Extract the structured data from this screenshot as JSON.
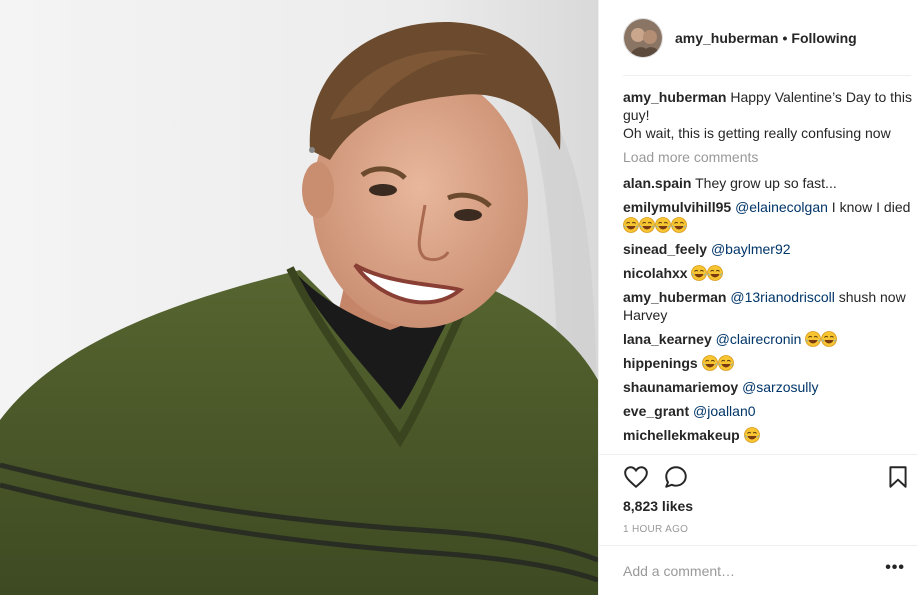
{
  "header": {
    "username": "amy_huberman",
    "separator": "•",
    "follow_status": "Following"
  },
  "caption": {
    "user": "amy_huberman",
    "line1": "Happy Valentine’s Day to this guy!",
    "line2": "Oh wait, this is getting really confusing now"
  },
  "load_more": "Load more comments",
  "comments": [
    {
      "user": "alan.spain",
      "mention": "",
      "text": "They grow up so fast...",
      "emoji": 0
    },
    {
      "user": "emilymulvihill95",
      "mention": "@elainecolgan",
      "text": "I know I died",
      "emoji": 4
    },
    {
      "user": "sinead_feely",
      "mention": "@baylmer92",
      "text": "",
      "emoji": 0
    },
    {
      "user": "nicolahxx",
      "mention": "",
      "text": "",
      "emoji": 2
    },
    {
      "user": "amy_huberman",
      "mention": "@13rianodriscoll",
      "text": "shush now Harvey",
      "emoji": 0
    },
    {
      "user": "lana_kearney",
      "mention": "@clairecronin",
      "text": "",
      "emoji": 2
    },
    {
      "user": "hippenings",
      "mention": "",
      "text": "",
      "emoji": 2
    },
    {
      "user": "shaunamariemoy",
      "mention": "@sarzosully",
      "text": "",
      "emoji": 0
    },
    {
      "user": "eve_grant",
      "mention": "@joallan0",
      "text": "",
      "emoji": 0
    },
    {
      "user": "michellekmakeup",
      "mention": "",
      "text": "",
      "emoji": 1
    }
  ],
  "likes": "8,823 likes",
  "timestamp": "1 HOUR AGO",
  "add_comment": {
    "placeholder": "Add a comment…"
  },
  "more_label": "•••",
  "icons": {
    "like": "heart-icon",
    "comment": "comment-bubble-icon",
    "save": "bookmark-icon",
    "emoji": "laughing-tears-emoji"
  },
  "colors": {
    "text": "#262626",
    "muted": "#999999",
    "mention": "#003569",
    "divider": "#efefef",
    "sweater": "#4c5a2a"
  }
}
